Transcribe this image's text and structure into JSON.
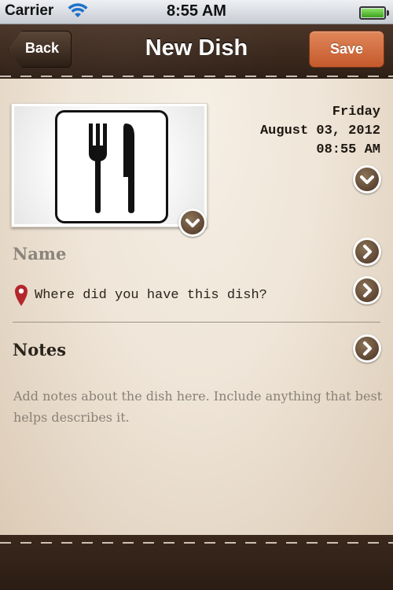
{
  "status_bar": {
    "carrier": "Carrier",
    "time": "8:55 AM",
    "wifi_icon": "wifi-icon",
    "battery_icon": "battery-icon"
  },
  "nav": {
    "title": "New Dish",
    "back_label": "Back",
    "save_label": "Save"
  },
  "photo": {
    "icon": "fork-knife-icon"
  },
  "date": {
    "weekday": "Friday",
    "date": "August 03, 2012",
    "time": "08:55 AM"
  },
  "form": {
    "name_label": "Name",
    "location_placeholder": "Where did you have this dish?",
    "location_icon": "map-pin-icon",
    "notes_label": "Notes",
    "notes_placeholder": "Add notes about the dish here. Include anything that best helps  describes it."
  },
  "colors": {
    "leather": "#3a281d",
    "save_button": "#d66e3f",
    "parchment": "#efe5d8",
    "chevron": "#6b5239"
  }
}
